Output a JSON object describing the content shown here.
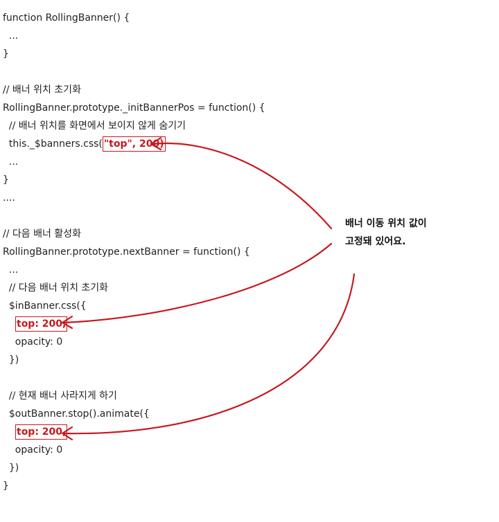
{
  "code": {
    "l1": "function RollingBanner() {",
    "l2": "  ...",
    "l3": "}",
    "l5": "// 배너 위치 초기화",
    "l6": "RollingBanner.prototype._initBannerPos = function() {",
    "l7": "  // 배너 위치를 화면에서 보이지 않게 숨기기",
    "l8_prefix": "  this._$banners.css(",
    "l8_highlight": "\"top\", 200)",
    "l9": "  ...",
    "l10": "}",
    "l11": "....",
    "l13": "// 다음 배너 활성화",
    "l14": "RollingBanner.prototype.nextBanner = function() {",
    "l15": "  ...",
    "l16": "  // 다음 배너 위치 초기화",
    "l17": "  $inBanner.css({",
    "l18_highlight": "top: 200,",
    "l19": "    opacity: 0",
    "l20": "  })",
    "l22": "  // 현재 배너 사라지게 하기",
    "l23": "  $outBanner.stop().animate({",
    "l24_highlight": "top: 200,",
    "l25": "    opacity: 0",
    "l26": "  })",
    "l27": "}"
  },
  "annotation": {
    "line1": "배너 이동 위치 값이",
    "line2": "고정돼 있어요."
  },
  "colors": {
    "highlight": "#c8171d",
    "text": "#222222"
  }
}
